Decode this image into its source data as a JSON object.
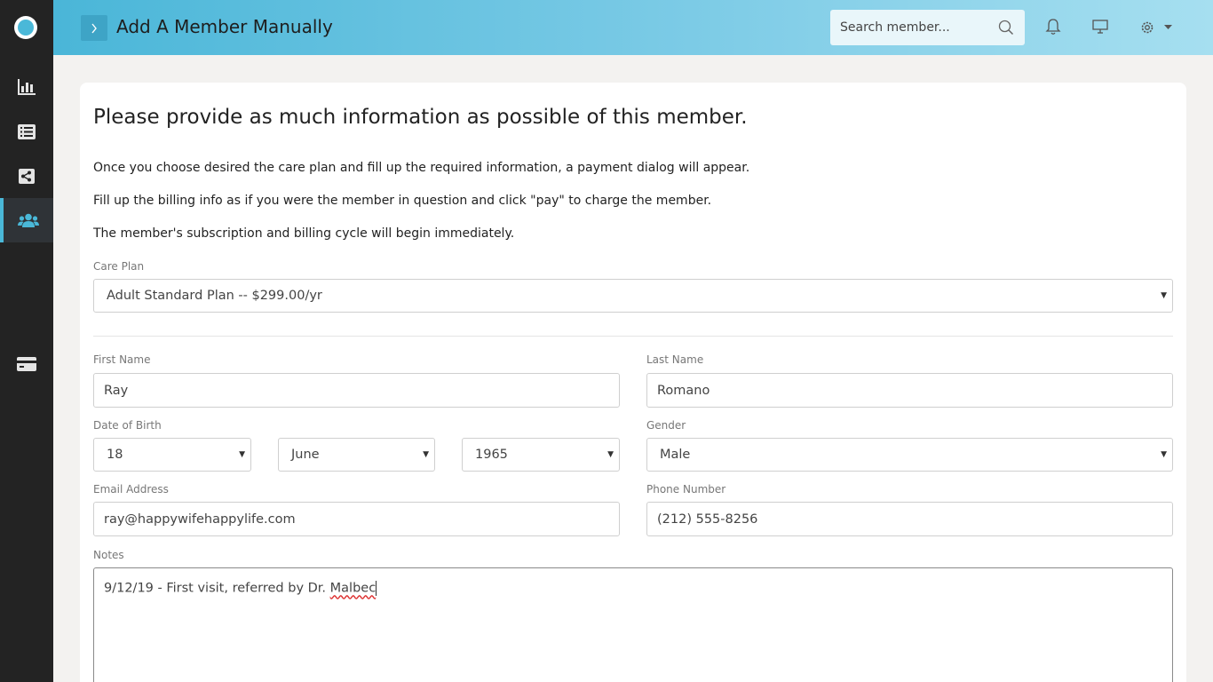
{
  "header": {
    "title": "Add A Member Manually",
    "search_placeholder": "Search member..."
  },
  "sidebar": {
    "items": [
      {
        "icon": "bar-chart-icon"
      },
      {
        "icon": "list-icon"
      },
      {
        "icon": "share-icon"
      },
      {
        "icon": "users-icon",
        "active": true
      },
      {
        "icon": "credit-card-icon"
      }
    ]
  },
  "content": {
    "heading": "Please provide as much information as possible of this member.",
    "paragraphs": [
      "Once you choose desired the care plan and fill up the required information, a payment dialog will appear.",
      "Fill up the billing info as if you were the member in question and click \"pay\" to charge the member.",
      "The member's subscription and billing cycle will begin immediately."
    ]
  },
  "form": {
    "care_plan": {
      "label": "Care Plan",
      "value": "Adult Standard Plan -- $299.00/yr"
    },
    "first_name": {
      "label": "First Name",
      "value": "Ray"
    },
    "last_name": {
      "label": "Last Name",
      "value": "Romano"
    },
    "dob": {
      "label": "Date of Birth",
      "day": "18",
      "month": "June",
      "year": "1965"
    },
    "gender": {
      "label": "Gender",
      "value": "Male"
    },
    "email": {
      "label": "Email Address",
      "value": "ray@happywifehappylife.com"
    },
    "phone": {
      "label": "Phone Number",
      "value": "(212) 555-8256"
    },
    "notes": {
      "label": "Notes",
      "value_prefix": "9/12/19 - First visit, referred by Dr. ",
      "value_misspelled": "Malbec"
    }
  },
  "colors": {
    "accent": "#4ab8d8",
    "sidebar": "#232323",
    "background": "#f3f2f0"
  }
}
